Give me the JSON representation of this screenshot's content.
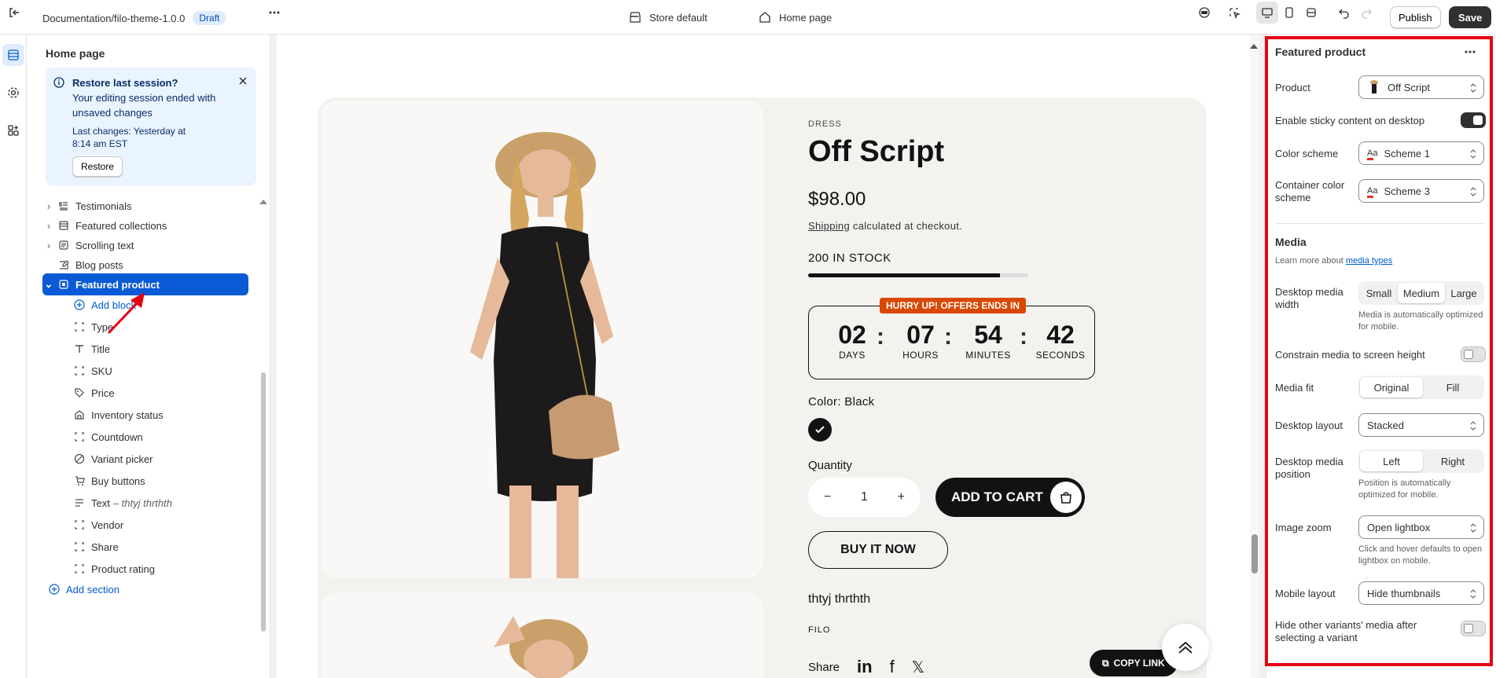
{
  "topbar": {
    "path": "Documentation/filo-theme-1.0.0",
    "status_badge": "Draft",
    "store": "Store default",
    "page": "Home page",
    "publish_label": "Publish",
    "save_label": "Save"
  },
  "sidebar": {
    "title": "Home page",
    "banner": {
      "title": "Restore last session?",
      "text": "Your editing session ended with unsaved changes",
      "last_changes": "Last changes: Yesterday at 8:14 am EST",
      "button": "Restore"
    },
    "sections": [
      {
        "label": "Testimonials",
        "icon": "testimonials-icon"
      },
      {
        "label": "Featured collections",
        "icon": "collection-icon"
      },
      {
        "label": "Scrolling text",
        "icon": "text-block-icon"
      },
      {
        "label": "Blog posts",
        "icon": "blog-icon"
      },
      {
        "label": "Featured product",
        "icon": "product-icon",
        "selected": true
      }
    ],
    "blocks": [
      {
        "label": "Add block",
        "icon": "plus-circle-icon"
      },
      {
        "label": "Type",
        "icon": "block-icon"
      },
      {
        "label": "Title",
        "icon": "title-icon"
      },
      {
        "label": "SKU",
        "icon": "block-icon"
      },
      {
        "label": "Price",
        "icon": "price-tag-icon"
      },
      {
        "label": "Inventory status",
        "icon": "inventory-icon"
      },
      {
        "label": "Countdown",
        "icon": "block-icon"
      },
      {
        "label": "Variant picker",
        "icon": "variant-icon"
      },
      {
        "label": "Buy buttons",
        "icon": "cart-icon"
      },
      {
        "label": "Text",
        "sub": "– thtyj thrthth",
        "icon": "text-lines-icon"
      },
      {
        "label": "Vendor",
        "icon": "block-icon"
      },
      {
        "label": "Share",
        "icon": "block-icon"
      },
      {
        "label": "Product rating",
        "icon": "block-icon"
      }
    ],
    "add_section": "Add section"
  },
  "preview": {
    "vendor": "DRESS",
    "title": "Off Script",
    "price": "$98.00",
    "shipping_link": "Shipping",
    "shipping_rest": " calculated at checkout.",
    "stock": "200 IN STOCK",
    "stock_fraction": 0.87,
    "countdown": {
      "badge": "HURRY UP! OFFERS ENDS IN",
      "days": "02",
      "days_label": "DAYS",
      "hours": "07",
      "hours_label": "HOURS",
      "minutes": "54",
      "minutes_label": "MINUTES",
      "seconds": "42",
      "seconds_label": "SECONDS"
    },
    "color_label": "Color: Black",
    "quantity_label": "Quantity",
    "quantity_value": "1",
    "add_to_cart": "ADD TO CART",
    "buy_now": "BUY IT NOW",
    "text": "thtyj thrthth",
    "vendor2": "FILO",
    "share_label": "Share",
    "copy_link": "COPY LINK"
  },
  "settings": {
    "title": "Featured product",
    "product_label": "Product",
    "product_value": "Off Script",
    "sticky_label": "Enable sticky content on desktop",
    "color_scheme_label": "Color scheme",
    "color_scheme_value": "Scheme 1",
    "container_label": "Container color scheme",
    "container_value": "Scheme 3",
    "media_heading": "Media",
    "media_learn": "Learn more about ",
    "media_learn_link": "media types",
    "desktop_width_label": "Desktop media width",
    "width_options": [
      "Small",
      "Medium",
      "Large"
    ],
    "width_help": "Media is automatically optimized for mobile.",
    "constrain_label": "Constrain media to screen height",
    "fit_label": "Media fit",
    "fit_options": [
      "Original",
      "Fill"
    ],
    "layout_label": "Desktop layout",
    "layout_value": "Stacked",
    "position_label": "Desktop media position",
    "position_options": [
      "Left",
      "Right"
    ],
    "position_help": "Position is automatically optimized for mobile.",
    "zoom_label": "Image zoom",
    "zoom_value": "Open lightbox",
    "zoom_help": "Click and hover defaults to open lightbox on mobile.",
    "mobile_label": "Mobile layout",
    "mobile_value": "Hide thumbnails",
    "hide_variants_label": "Hide other variants' media after selecting a variant",
    "accent_color": "#e50012"
  }
}
